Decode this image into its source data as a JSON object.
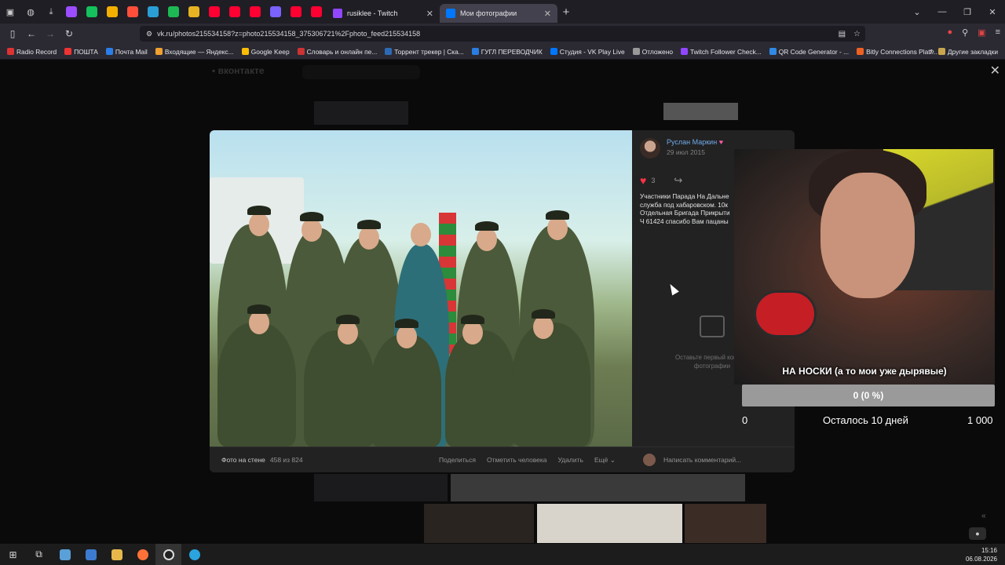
{
  "browser": {
    "pinned_tab_colors": [
      "#9b4dff",
      "#14c15c",
      "#f4b000",
      "#ff4f3a",
      "#2a9fd6",
      "#1db954",
      "#e6b422",
      "#ff0033",
      "#ff0033",
      "#ff0033",
      "#7b62ff",
      "#ff0033",
      "#ff0033"
    ],
    "tabs": [
      {
        "label": "rusiklee - Twitch",
        "active": false
      },
      {
        "label": "Мои фотографии",
        "active": true
      }
    ],
    "url": "vk.ru/photos215534158?z=photo215534158_375306721%2Fphoto_feed215534158",
    "bookmarks": [
      "Radio Record",
      "ПОШТА",
      "Почта Mail",
      "Входящие — Яндекс...",
      "Google Keep",
      "Словарь и онлайн пе...",
      "Торрент трекер | Ска...",
      "ГУГЛ ПЕРЕВОДЧИК",
      "Студия - VK Play Live",
      "Отложено",
      "Twitch Follower Check...",
      "QR Code Generator - ...",
      "Bitly Connections Platf..."
    ],
    "other_bookmarks": "Другие закладки"
  },
  "viewer": {
    "author": "Руслан Маркин",
    "date": "29 июл 2015",
    "likes": "3",
    "description": "Участники Парада На Дальне\nслужба под хабаровском. 10к\nОтдельная Бригада Прикрыти\nЧ 61424 спасибо Вам пацаны",
    "no_comments": "Оставьте первый коммен\nфотографии",
    "footer": {
      "album": "Фото на стене",
      "counter": "458 из 824",
      "actions": [
        "Поделиться",
        "Отметить человека",
        "Удалить",
        "Ещё ⌄"
      ],
      "comment_placeholder": "Написать комментарий..."
    }
  },
  "stream_widget": {
    "goal_title": "НА НОСКИ (а то мои уже дырявые)",
    "progress_label": "0 (0 %)",
    "progress_fraction": 0,
    "min": "0",
    "remaining": "Осталось 10 дней",
    "max": "1 000"
  },
  "taskbar": {
    "time": "15:16",
    "date": "06.08.2026"
  },
  "colors": {
    "vk_link": "#71aaeb",
    "like": "#ff3347",
    "browser_tab_active": "#42414d"
  }
}
